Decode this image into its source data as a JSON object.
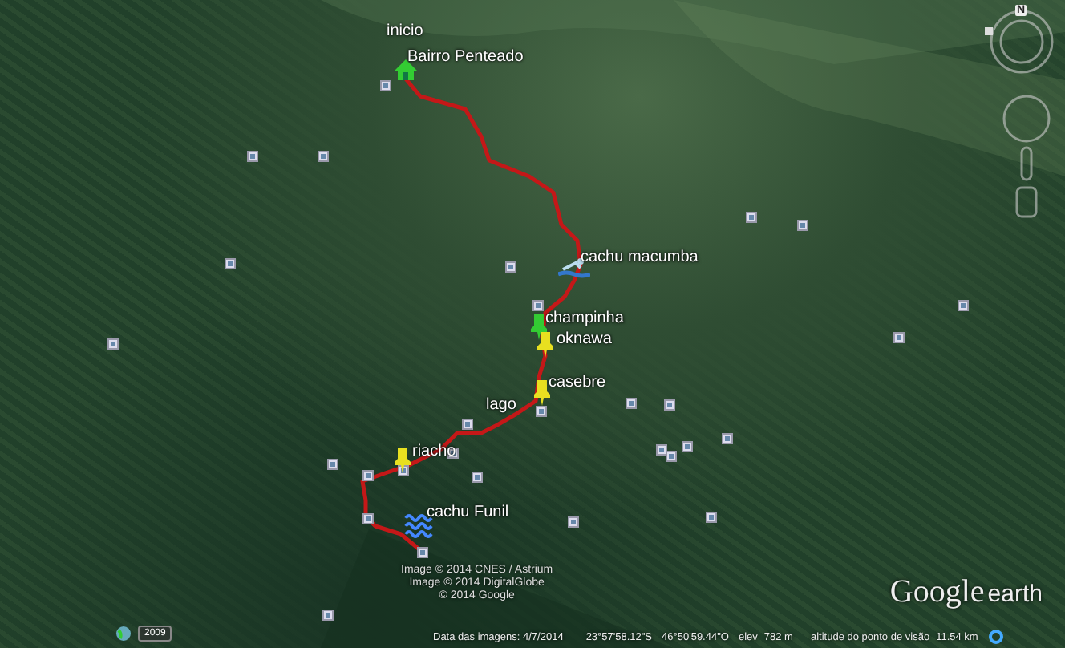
{
  "placemarks": [
    {
      "label": "inicio",
      "kind": "none"
    },
    {
      "label": "Bairro Penteado",
      "kind": "house"
    },
    {
      "label": "cachu macumba",
      "kind": "swimmer"
    },
    {
      "label": "champinha",
      "kind": "pushpin",
      "color": "#33cc33"
    },
    {
      "label": "oknawa",
      "kind": "pushpin",
      "color": "#e8e020"
    },
    {
      "label": "casebre",
      "kind": "pushpin",
      "color": "#e8e020"
    },
    {
      "label": "lago",
      "kind": "none"
    },
    {
      "label": "riacho",
      "kind": "pushpin",
      "color": "#e8e020"
    },
    {
      "label": "cachu Funil",
      "kind": "waves"
    }
  ],
  "attribution": [
    "Image © 2014 CNES / Astrium",
    "Image © 2014 DigitalGlobe",
    "© 2014 Google"
  ],
  "logo": {
    "brand": "Google",
    "product": "earth"
  },
  "historical_imagery": {
    "year": "2009"
  },
  "status_bar": {
    "imagery_date": "Data das imagens: 4/7/2014",
    "latitude": "23°57'58.12\"S",
    "longitude": "46°50'59.44\"O",
    "elevation_label": "elev",
    "elevation": "782 m",
    "eye_altitude_label": "altitude do ponto de visão",
    "eye_altitude": "11.54 km"
  },
  "compass": {
    "north": "N"
  }
}
